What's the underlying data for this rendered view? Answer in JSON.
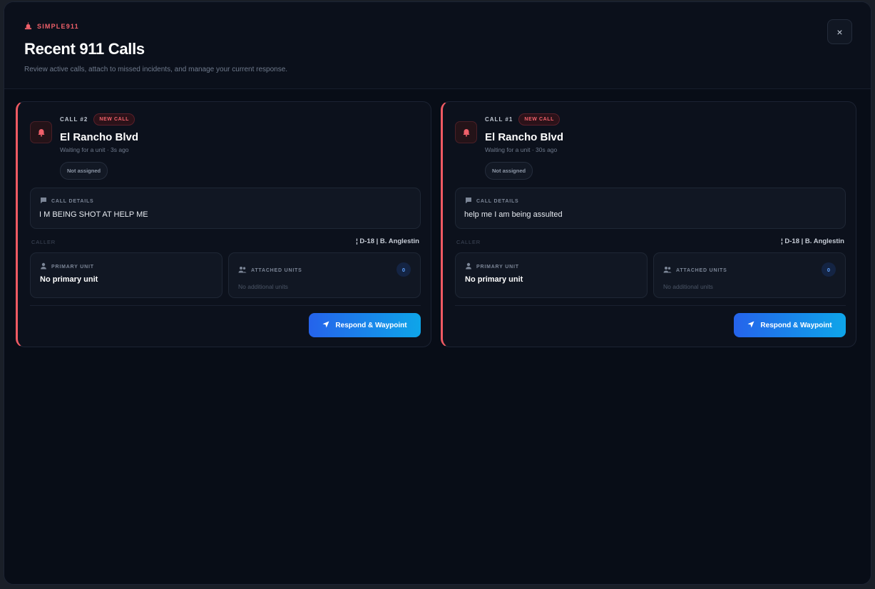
{
  "header": {
    "brand": "SIMPLE911",
    "title": "Recent 911 Calls",
    "subtitle": "Review active calls, attach to missed incidents, and manage your current response."
  },
  "close_label": "×",
  "labels": {
    "call_details": "CALL DETAILS",
    "caller": "CALLER",
    "primary_unit": "PRIMARY UNIT",
    "attached_units": "ATTACHED UNITS",
    "respond": "Respond & Waypoint"
  },
  "calls": [
    {
      "number": "CALL #2",
      "badge": "NEW CALL",
      "location": "El Rancho Blvd",
      "status": "Waiting for a unit · 3s ago",
      "assignment": "Not assigned",
      "details": "I M BEING SHOT AT HELP ME",
      "caller": "¦ D-18 | B. Anglestin",
      "primary_unit": "No primary unit",
      "attached_count": "0",
      "attached_empty": "No additional units"
    },
    {
      "number": "CALL #1",
      "badge": "NEW CALL",
      "location": "El Rancho Blvd",
      "status": "Waiting for a unit · 30s ago",
      "assignment": "Not assigned",
      "details": "help me I am being assulted",
      "caller": "¦ D-18 | B. Anglestin",
      "primary_unit": "No primary unit",
      "attached_count": "0",
      "attached_empty": "No additional units"
    }
  ],
  "colors": {
    "accent_red": "#ef5a63",
    "accent_blue": "#2563eb",
    "accent_cyan": "#0ea5e9",
    "background": "#080d17"
  },
  "icons": {
    "brand": "siren-icon",
    "alert": "bell-icon",
    "details": "message-icon",
    "primary": "user-icon",
    "attached": "users-icon",
    "respond": "navigation-arrow-icon",
    "close": "close-icon"
  }
}
